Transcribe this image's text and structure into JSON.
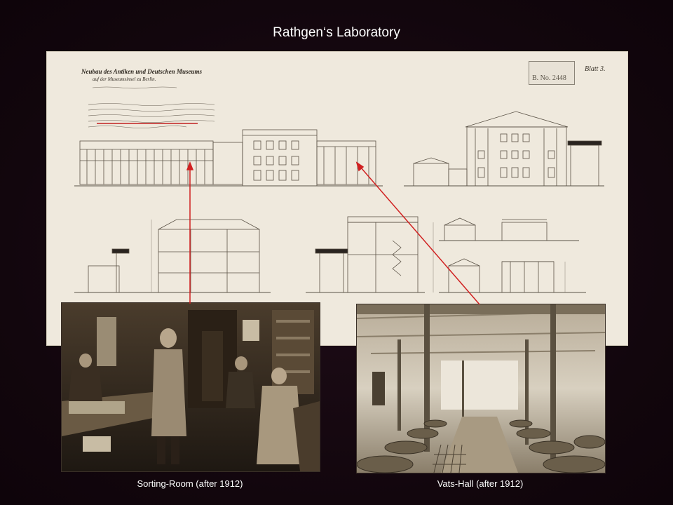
{
  "slide": {
    "title": "Rathgen‘s Laboratory",
    "plan": {
      "heading_line1": "Neubau des Antiken und Deutschen Museums",
      "heading_line2": "auf der Museumsinsel zu Berlin.",
      "sheet_label": "Blatt 3.",
      "stamp_number": "B. No. 2448"
    },
    "photos": [
      {
        "caption": "Sorting-Room (after 1912)"
      },
      {
        "caption": "Vats-Hall (after 1912)"
      }
    ],
    "colors": {
      "background": "#150810",
      "plan_paper": "#efe9dd",
      "ink": "#4a4238",
      "arrow": "#d02020",
      "text": "#ffffff"
    }
  }
}
